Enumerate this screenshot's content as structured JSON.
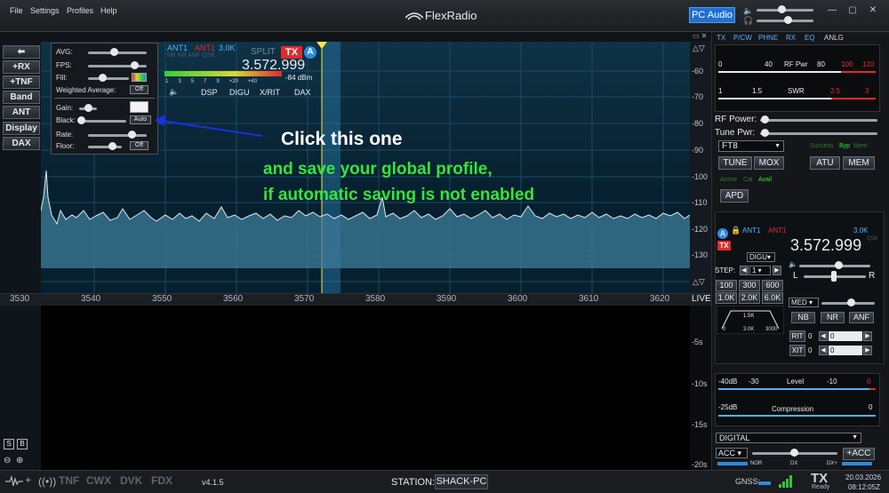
{
  "menu": {
    "file": "File",
    "settings": "Settings",
    "profiles": "Profiles",
    "help": "Help"
  },
  "brand": "FlexRadio",
  "pc_audio": "PC Audio",
  "left_buttons": [
    "+RX",
    "+TNF",
    "Band",
    "ANT",
    "Display",
    "DAX"
  ],
  "display_popup": {
    "avg": "AVG:",
    "fps": "FPS:",
    "fill": "Fill:",
    "weighted_average": "Weighted Average:",
    "weighted_value": "Off",
    "gain": "Gain:",
    "black": "Black:",
    "black_value": "Auto",
    "rate": "Rate:",
    "floor": "Floor:",
    "floor_value": "Off"
  },
  "slice": {
    "ant1": "ANT1",
    "ant1_tx": "ANT1",
    "bw": "3.0K",
    "split": "SPLIT",
    "tx": "TX",
    "letter": "A",
    "frequency": "3.572.999",
    "dbm": "-84 dBm",
    "s_scale": [
      "1",
      "3",
      "5",
      "7",
      "9",
      "+20",
      "+40"
    ],
    "tabs": [
      "DSP",
      "DIGU",
      "X/RIT",
      "DAX"
    ],
    "sub": "NB NR ANF QSK"
  },
  "db_scale": [
    "-60",
    "-70",
    "-80",
    "-90",
    "-100",
    "-110",
    "-120",
    "-130"
  ],
  "freq_scale": [
    "3530",
    "3540",
    "3550",
    "3560",
    "3570",
    "3580",
    "3590",
    "3600",
    "3610",
    "3620"
  ],
  "live": "LIVE",
  "wf_scale": [
    "-5s",
    "-10s",
    "-15s",
    "-20s"
  ],
  "annotations": {
    "click": "Click this one",
    "save1": "and save your global profile,",
    "save2": "if automatic saving is not enabled"
  },
  "right_tabs": [
    "TX",
    "P/CW",
    "PHNE",
    "RX",
    "EQ",
    "ANLG"
  ],
  "rf_meter": {
    "left": "0",
    "mid": "40",
    "label": "RF Pwr",
    "v80": "80",
    "v100": "100",
    "v120": "120"
  },
  "swr_meter": {
    "left": "1",
    "mid": "1.5",
    "label": "SWR",
    "v25": "2.5",
    "v3": "3"
  },
  "rf_power": "RF Power:",
  "tune_pwr": "Tune Pwr:",
  "profile": "FT8",
  "tune": "TUNE",
  "mox": "MOX",
  "atu": "ATU",
  "mem": "MEM",
  "atu_status": {
    "success": "Success",
    "byp": "Byp",
    "mem": "Mem"
  },
  "active_cal": {
    "active": "Active",
    "cal": "Cal",
    "avail": "Avail"
  },
  "apd": "APD",
  "slice_panel": {
    "ant1": "ANT1",
    "ant1_tx": "ANT1",
    "bw": "3.0K",
    "qsk": "QSK",
    "frequency": "3.572.999",
    "mode": "DIGU",
    "step_label": "STEP:",
    "step_value": "1",
    "filters": [
      "100",
      "300",
      "600",
      "1.0K",
      "2.0K",
      "6.0K"
    ],
    "filter_width": "1.5K",
    "filter_lo": "0",
    "filter_mid": "3.0K",
    "filter_hi": "3000",
    "agc": "MED",
    "l": "L",
    "r": "R",
    "nb": "NB",
    "nr": "NR",
    "anf": "ANF",
    "rit": "RIT",
    "xit": "XIT",
    "rit_val": "0",
    "xit_val": "0",
    "zero": "0"
  },
  "level_meter": {
    "a": "-40dB",
    "b": "-30",
    "label": "Level",
    "c": "-10",
    "d": "0"
  },
  "comp_meter": {
    "a": "-25dB",
    "label": "Compression",
    "b": "0"
  },
  "digital": "DIGITAL",
  "acc": "ACC",
  "plus_acc": "+ACC",
  "bottom_labels": {
    "nor": "NOR",
    "dx": "DX",
    "dxplus": "DX+"
  },
  "status": {
    "tnf": "TNF",
    "cwx": "CWX",
    "dvk": "DVK",
    "fdx": "FDX",
    "version": "v4.1.5",
    "station_label": "STATION:",
    "station": "SHACK-PC",
    "gnss": "GNSS:",
    "tx": "TX",
    "ready": "Ready",
    "date": "20.03.2026",
    "time": "08:12:05Z"
  },
  "colors": {
    "accent": "#1f6fd1",
    "tx_red": "#e02b2b",
    "green_text": "#33e63a",
    "pan_bg": "#0a2a3c"
  }
}
